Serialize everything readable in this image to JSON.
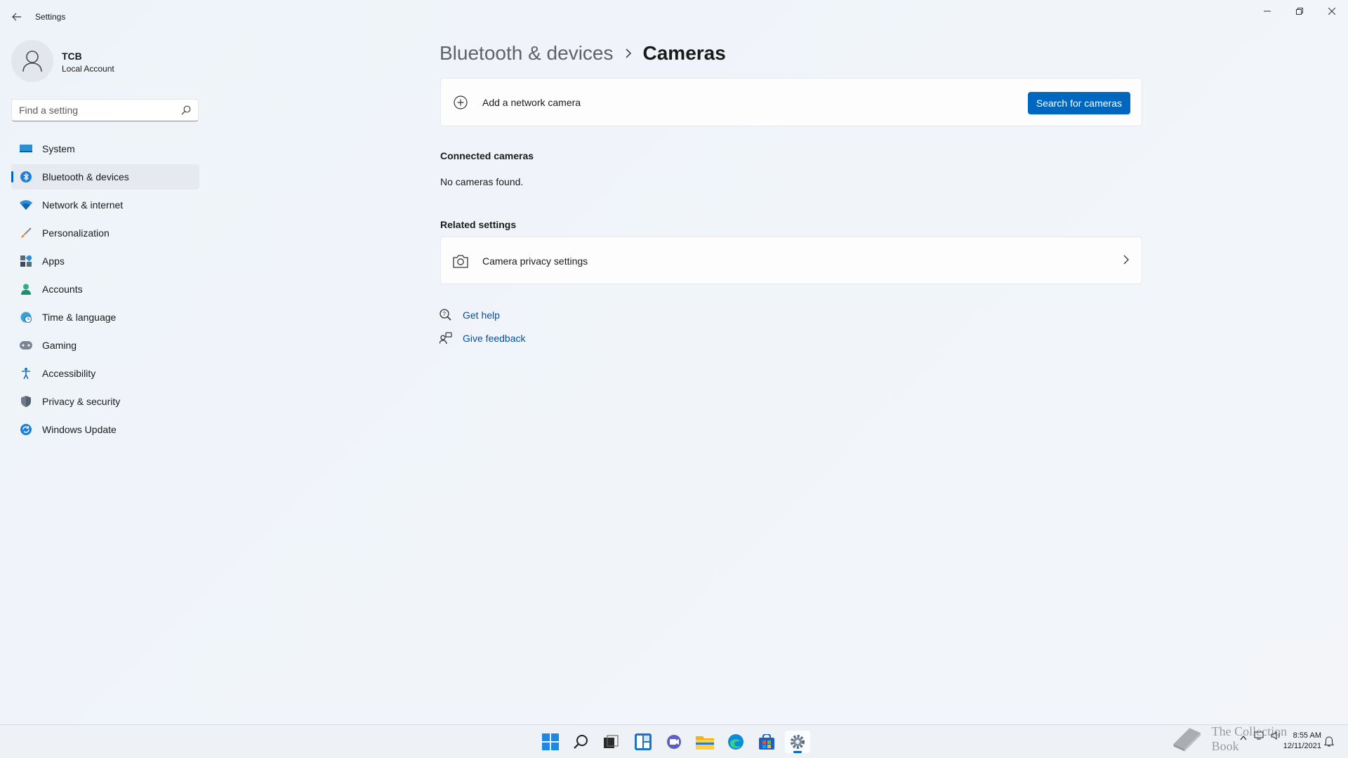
{
  "window": {
    "app_title": "Settings"
  },
  "profile": {
    "name": "TCB",
    "account_type": "Local Account"
  },
  "search": {
    "placeholder": "Find a setting"
  },
  "sidebar": {
    "items": [
      {
        "label": "System",
        "icon": "system-icon",
        "active": false
      },
      {
        "label": "Bluetooth & devices",
        "icon": "bluetooth-icon",
        "active": true
      },
      {
        "label": "Network & internet",
        "icon": "wifi-icon",
        "active": false
      },
      {
        "label": "Personalization",
        "icon": "brush-icon",
        "active": false
      },
      {
        "label": "Apps",
        "icon": "apps-icon",
        "active": false
      },
      {
        "label": "Accounts",
        "icon": "person-icon",
        "active": false
      },
      {
        "label": "Time & language",
        "icon": "globe-clock-icon",
        "active": false
      },
      {
        "label": "Gaming",
        "icon": "gamepad-icon",
        "active": false
      },
      {
        "label": "Accessibility",
        "icon": "accessibility-icon",
        "active": false
      },
      {
        "label": "Privacy & security",
        "icon": "shield-icon",
        "active": false
      },
      {
        "label": "Windows Update",
        "icon": "update-icon",
        "active": false
      }
    ]
  },
  "breadcrumb": {
    "parent": "Bluetooth & devices",
    "current": "Cameras"
  },
  "add_camera": {
    "label": "Add a network camera",
    "button_label": "Search for cameras"
  },
  "connected": {
    "title": "Connected cameras",
    "empty_text": "No cameras found."
  },
  "related": {
    "title": "Related settings",
    "items": [
      {
        "label": "Camera privacy settings",
        "icon": "camera-icon"
      }
    ]
  },
  "help_links": {
    "get_help": "Get help",
    "give_feedback": "Give feedback"
  },
  "taskbar": {
    "apps": [
      "start",
      "search",
      "task-view",
      "widgets",
      "chat",
      "file-explorer",
      "edge",
      "store",
      "settings"
    ],
    "active_app": "settings",
    "time": "8:55 AM",
    "date": "12/11/2021"
  },
  "watermark": {
    "text": "The Collection Book"
  },
  "colors": {
    "accent": "#0067c0",
    "link": "#0050a5",
    "background": "#f0f4f9"
  }
}
